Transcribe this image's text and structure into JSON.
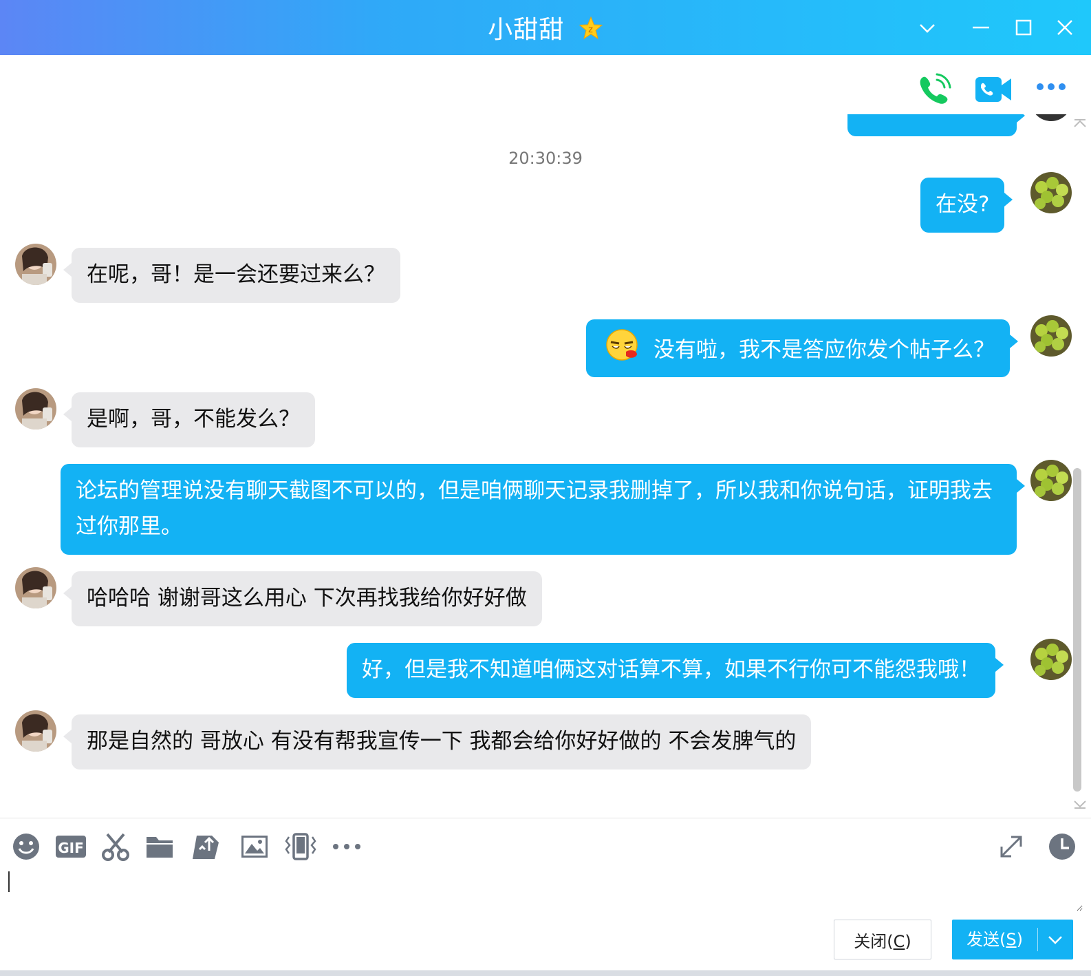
{
  "window": {
    "title": "小甜甜",
    "controls": [
      "chevron-down-icon",
      "minimize-icon",
      "maximize-icon",
      "close-icon"
    ]
  },
  "colors": {
    "title_gradient_start": "#5c86f5",
    "title_gradient_end": "#1fc8fb",
    "outgoing_bubble": "#13b2f4",
    "incoming_bubble": "#e9e9eb",
    "phone_icon": "#15c95f",
    "video_icon": "#13b2f4"
  },
  "header_actions": [
    "phone-call-icon",
    "video-call-icon",
    "more-icon"
  ],
  "chat": {
    "timestamp": "20:30:39",
    "messages": [
      {
        "dir": "out",
        "text": "在没?"
      },
      {
        "dir": "in",
        "text": "在呢，哥！是一会还要过来么？"
      },
      {
        "dir": "out",
        "emoji": "emoji-icon",
        "text": "没有啦，我不是答应你发个帖子么？"
      },
      {
        "dir": "in",
        "text": "是啊，哥，不能发么？"
      },
      {
        "dir": "out",
        "text": "论坛的管理说没有聊天截图不可以的，但是咱俩聊天记录我删掉了，所以我和你说句话，证明我去过你那里。"
      },
      {
        "dir": "in",
        "text": "哈哈哈 谢谢哥这么用心 下次再找我给你好好做"
      },
      {
        "dir": "out",
        "text": "好，但是我不知道咱俩这对话算不算，如果不行你可不能怨我哦！"
      },
      {
        "dir": "in",
        "text": "那是自然的 哥放心 有没有帮我宣传一下 我都会给你好好做的 不会发脾气的"
      }
    ]
  },
  "toolbar": {
    "tools": [
      "emoji-icon",
      "gif-icon",
      "scissors-icon",
      "folder-icon",
      "file-transfer-icon",
      "image-icon",
      "shake-icon",
      "more-icon"
    ],
    "gif_label": "GIF",
    "right_tools": [
      "expand-icon",
      "history-icon"
    ]
  },
  "input": {
    "value": ""
  },
  "buttons": {
    "close_label": "关闭(",
    "close_key": "C",
    "close_suffix": ")",
    "send_label": "发送(",
    "send_key": "S",
    "send_suffix": ")"
  }
}
